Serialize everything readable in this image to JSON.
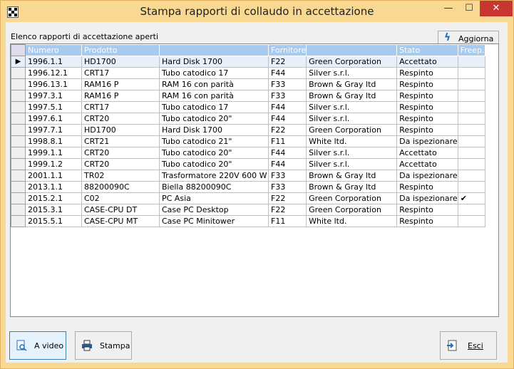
{
  "window": {
    "title": "Stampa rapporti di collaudo in accettazione",
    "minimize": "—",
    "maximize": "☐",
    "close": "✕"
  },
  "caption": "Elenco rapporti di accettazione aperti",
  "refresh_label": "Aggiorna",
  "columns": [
    "Numero",
    "Prodotto",
    "",
    "Fornitore",
    "",
    "Stato",
    "Freep."
  ],
  "rows": [
    [
      "1996.1.1",
      "HD1700",
      "Hard Disk 1700",
      "F22",
      "Green Corporation",
      "Accettato",
      ""
    ],
    [
      "1996.12.1",
      "CRT17",
      "Tubo catodico 17",
      "F44",
      "Silver s.r.l.",
      "Respinto",
      ""
    ],
    [
      "1996.13.1",
      "RAM16 P",
      "RAM 16 con parità",
      "F33",
      "Brown & Gray ltd",
      "Respinto",
      ""
    ],
    [
      "1997.3.1",
      "RAM16 P",
      "RAM 16 con parità",
      "F33",
      "Brown & Gray ltd",
      "Respinto",
      ""
    ],
    [
      "1997.5.1",
      "CRT17",
      "Tubo catodico 17",
      "F44",
      "Silver s.r.l.",
      "Respinto",
      ""
    ],
    [
      "1997.6.1",
      "CRT20",
      "Tubo catodico 20\"",
      "F44",
      "Silver s.r.l.",
      "Respinto",
      ""
    ],
    [
      "1997.7.1",
      "HD1700",
      "Hard Disk 1700",
      "F22",
      "Green Corporation",
      "Respinto",
      ""
    ],
    [
      "1998.8.1",
      "CRT21",
      "Tubo catodico 21\"",
      "F11",
      "White ltd.",
      "Da ispezionare",
      ""
    ],
    [
      "1999.1.1",
      "CRT20",
      "Tubo catodico 20\"",
      "F44",
      "Silver s.r.l.",
      "Accettato",
      ""
    ],
    [
      "1999.1.2",
      "CRT20",
      "Tubo catodico 20\"",
      "F44",
      "Silver s.r.l.",
      "Accettato",
      ""
    ],
    [
      "2001.1.1",
      "TR02",
      "Trasformatore 220V 600 W",
      "F33",
      "Brown & Gray ltd",
      "Da ispezionare",
      ""
    ],
    [
      "2013.1.1",
      "88200090C",
      "Biella 88200090C",
      "F33",
      "Brown & Gray ltd",
      "Respinto",
      ""
    ],
    [
      "2015.2.1",
      "C02",
      "PC Asia",
      "F22",
      "Green Corporation",
      "Da ispezionare",
      "✔"
    ],
    [
      "2015.3.1",
      "CASE-CPU DT",
      "Case PC Desktop",
      "F22",
      "Green Corporation",
      "Respinto",
      ""
    ],
    [
      "2015.5.1",
      "CASE-CPU MT",
      "Case PC Minitower",
      "F11",
      "White ltd.",
      "Respinto",
      ""
    ]
  ],
  "current_row_marker": "▶",
  "buttons": {
    "video": "A video",
    "print": "Stampa",
    "exit": "Esci"
  }
}
